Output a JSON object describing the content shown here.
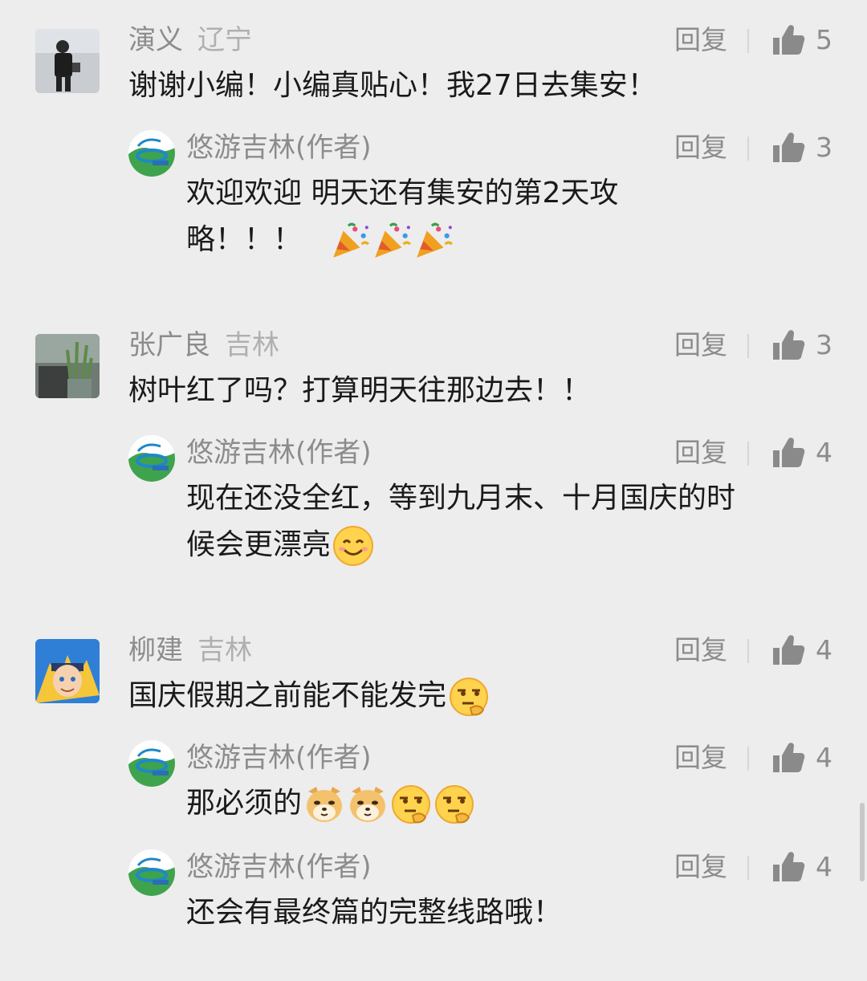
{
  "comments": [
    {
      "name": "演义",
      "location": "辽宁",
      "text": "谢谢小编！小编真贴心！我27日去集安！",
      "reply_label": "回复",
      "likes": "5",
      "reply": {
        "name": "悠游吉林(作者)",
        "text": "欢迎欢迎  明天还有集安的第2天攻",
        "text_line2": "略！！！",
        "reply_label": "回复",
        "likes": "3",
        "emoji": "party-popper-icon x3"
      }
    },
    {
      "name": "张广良",
      "location": "吉林",
      "text": "树叶红了吗？打算明天往那边去！！",
      "reply_label": "回复",
      "likes": "3",
      "reply": {
        "name": "悠游吉林(作者)",
        "text": "现在还没全红，等到九月末、十月国庆的时",
        "text_line2": "候会更漂亮",
        "reply_label": "回复",
        "likes": "4",
        "emoji": "smile-icon"
      }
    },
    {
      "name": "柳建",
      "location": "吉林",
      "text": "国庆假期之前能不能发完",
      "reply_label": "回复",
      "likes": "4",
      "emoji": "thinking-face-icon",
      "replies": [
        {
          "name": "悠游吉林(作者)",
          "text": "那必须的",
          "reply_label": "回复",
          "likes": "4",
          "emoji": "doge-icon x2, thinking-face-icon x2"
        },
        {
          "name": "悠游吉林(作者)",
          "text": "还会有最终篇的完整线路哦！",
          "reply_label": "回复",
          "likes": "4"
        }
      ]
    }
  ],
  "colors": {
    "background": "#ededed",
    "meta_text": "#8c8c8c",
    "body_text": "#1a1a1a",
    "like_icon": "#8c8c8c"
  }
}
